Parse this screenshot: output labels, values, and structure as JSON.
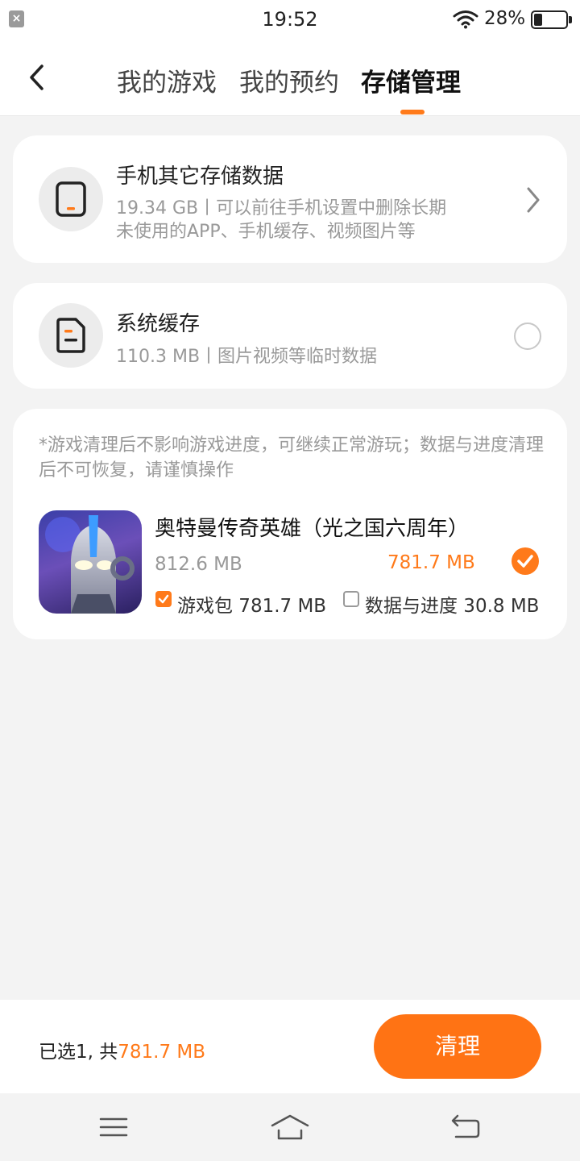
{
  "status_bar": {
    "time": "19:52",
    "battery_percent": "28%",
    "battery_level": 0.28,
    "left_icon": "close-notification-icon"
  },
  "header": {
    "back_icon": "chevron-left-icon",
    "tabs": [
      {
        "label": "我的游戏",
        "active": false
      },
      {
        "label": "我的预约",
        "active": false
      },
      {
        "label": "存储管理",
        "active": true
      }
    ]
  },
  "phone_storage": {
    "title": "手机其它存储数据",
    "line1": "19.34 GB丨可以前往手机设置中删除长期",
    "line2": "未使用的APP、手机缓存、视频图片等",
    "icon": "phone-icon"
  },
  "system_cache": {
    "title": "系统缓存",
    "subtitle": "110.3 MB丨图片视频等临时数据",
    "icon": "document-icon",
    "selected": false
  },
  "games": {
    "note": "*游戏清理后不影响游戏进度，可继续正常游玩；数据与进度清理后不可恢复，请谨慎操作",
    "items": [
      {
        "name": "奥特曼传奇英雄（光之国六周年）",
        "total_size": "812.6 MB",
        "selected_size": "781.7 MB",
        "selected": true,
        "package_label": "游戏包 781.7 MB",
        "package_checked": true,
        "data_label": "数据与进度 30.8 MB",
        "data_checked": false
      }
    ]
  },
  "bottom": {
    "summary_prefix": "已选1, 共",
    "summary_size": "781.7 MB",
    "clean_label": "清理"
  },
  "nav": {
    "menu_icon": "menu-icon",
    "home_icon": "home-icon",
    "back_icon": "back-icon"
  },
  "colors": {
    "accent": "#ff7a1a",
    "background": "#f3f3f3"
  }
}
